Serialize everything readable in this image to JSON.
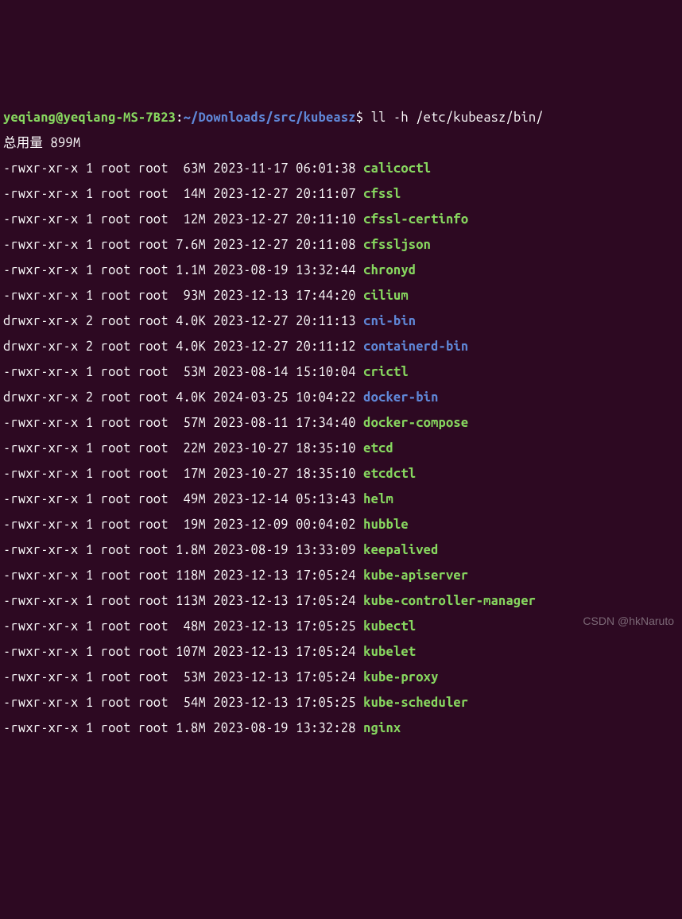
{
  "prompt": {
    "user_host": "yeqiang@yeqiang-MS-7B23",
    "colon": ":",
    "path": "~/Downloads/src/kubeasz",
    "dollar": "$ ",
    "command": "ll -h /etc/kubeasz/bin/"
  },
  "summary": "总用量 899M",
  "entries": [
    {
      "perms": "-rwxr-xr-x",
      "links": "1",
      "owner": "root",
      "group": "root",
      "size": " 63M",
      "date": "2023-11-17",
      "time": "06:01:38",
      "name": "calicoctl",
      "type": "exec"
    },
    {
      "perms": "-rwxr-xr-x",
      "links": "1",
      "owner": "root",
      "group": "root",
      "size": " 14M",
      "date": "2023-12-27",
      "time": "20:11:07",
      "name": "cfssl",
      "type": "exec"
    },
    {
      "perms": "-rwxr-xr-x",
      "links": "1",
      "owner": "root",
      "group": "root",
      "size": " 12M",
      "date": "2023-12-27",
      "time": "20:11:10",
      "name": "cfssl-certinfo",
      "type": "exec"
    },
    {
      "perms": "-rwxr-xr-x",
      "links": "1",
      "owner": "root",
      "group": "root",
      "size": "7.6M",
      "date": "2023-12-27",
      "time": "20:11:08",
      "name": "cfssljson",
      "type": "exec"
    },
    {
      "perms": "-rwxr-xr-x",
      "links": "1",
      "owner": "root",
      "group": "root",
      "size": "1.1M",
      "date": "2023-08-19",
      "time": "13:32:44",
      "name": "chronyd",
      "type": "exec"
    },
    {
      "perms": "-rwxr-xr-x",
      "links": "1",
      "owner": "root",
      "group": "root",
      "size": " 93M",
      "date": "2023-12-13",
      "time": "17:44:20",
      "name": "cilium",
      "type": "exec"
    },
    {
      "perms": "drwxr-xr-x",
      "links": "2",
      "owner": "root",
      "group": "root",
      "size": "4.0K",
      "date": "2023-12-27",
      "time": "20:11:13",
      "name": "cni-bin",
      "type": "dir"
    },
    {
      "perms": "drwxr-xr-x",
      "links": "2",
      "owner": "root",
      "group": "root",
      "size": "4.0K",
      "date": "2023-12-27",
      "time": "20:11:12",
      "name": "containerd-bin",
      "type": "dir"
    },
    {
      "perms": "-rwxr-xr-x",
      "links": "1",
      "owner": "root",
      "group": "root",
      "size": " 53M",
      "date": "2023-08-14",
      "time": "15:10:04",
      "name": "crictl",
      "type": "exec"
    },
    {
      "perms": "drwxr-xr-x",
      "links": "2",
      "owner": "root",
      "group": "root",
      "size": "4.0K",
      "date": "2024-03-25",
      "time": "10:04:22",
      "name": "docker-bin",
      "type": "dir"
    },
    {
      "perms": "-rwxr-xr-x",
      "links": "1",
      "owner": "root",
      "group": "root",
      "size": " 57M",
      "date": "2023-08-11",
      "time": "17:34:40",
      "name": "docker-compose",
      "type": "exec"
    },
    {
      "perms": "-rwxr-xr-x",
      "links": "1",
      "owner": "root",
      "group": "root",
      "size": " 22M",
      "date": "2023-10-27",
      "time": "18:35:10",
      "name": "etcd",
      "type": "exec"
    },
    {
      "perms": "-rwxr-xr-x",
      "links": "1",
      "owner": "root",
      "group": "root",
      "size": " 17M",
      "date": "2023-10-27",
      "time": "18:35:10",
      "name": "etcdctl",
      "type": "exec"
    },
    {
      "perms": "-rwxr-xr-x",
      "links": "1",
      "owner": "root",
      "group": "root",
      "size": " 49M",
      "date": "2023-12-14",
      "time": "05:13:43",
      "name": "helm",
      "type": "exec"
    },
    {
      "perms": "-rwxr-xr-x",
      "links": "1",
      "owner": "root",
      "group": "root",
      "size": " 19M",
      "date": "2023-12-09",
      "time": "00:04:02",
      "name": "hubble",
      "type": "exec"
    },
    {
      "perms": "-rwxr-xr-x",
      "links": "1",
      "owner": "root",
      "group": "root",
      "size": "1.8M",
      "date": "2023-08-19",
      "time": "13:33:09",
      "name": "keepalived",
      "type": "exec"
    },
    {
      "perms": "-rwxr-xr-x",
      "links": "1",
      "owner": "root",
      "group": "root",
      "size": "118M",
      "date": "2023-12-13",
      "time": "17:05:24",
      "name": "kube-apiserver",
      "type": "exec"
    },
    {
      "perms": "-rwxr-xr-x",
      "links": "1",
      "owner": "root",
      "group": "root",
      "size": "113M",
      "date": "2023-12-13",
      "time": "17:05:24",
      "name": "kube-controller-manager",
      "type": "exec"
    },
    {
      "perms": "-rwxr-xr-x",
      "links": "1",
      "owner": "root",
      "group": "root",
      "size": " 48M",
      "date": "2023-12-13",
      "time": "17:05:25",
      "name": "kubectl",
      "type": "exec"
    },
    {
      "perms": "-rwxr-xr-x",
      "links": "1",
      "owner": "root",
      "group": "root",
      "size": "107M",
      "date": "2023-12-13",
      "time": "17:05:24",
      "name": "kubelet",
      "type": "exec"
    },
    {
      "perms": "-rwxr-xr-x",
      "links": "1",
      "owner": "root",
      "group": "root",
      "size": " 53M",
      "date": "2023-12-13",
      "time": "17:05:24",
      "name": "kube-proxy",
      "type": "exec"
    },
    {
      "perms": "-rwxr-xr-x",
      "links": "1",
      "owner": "root",
      "group": "root",
      "size": " 54M",
      "date": "2023-12-13",
      "time": "17:05:25",
      "name": "kube-scheduler",
      "type": "exec"
    },
    {
      "perms": "-rwxr-xr-x",
      "links": "1",
      "owner": "root",
      "group": "root",
      "size": "1.8M",
      "date": "2023-08-19",
      "time": "13:32:28",
      "name": "nginx",
      "type": "exec"
    }
  ],
  "watermark": "CSDN @hkNaruto"
}
